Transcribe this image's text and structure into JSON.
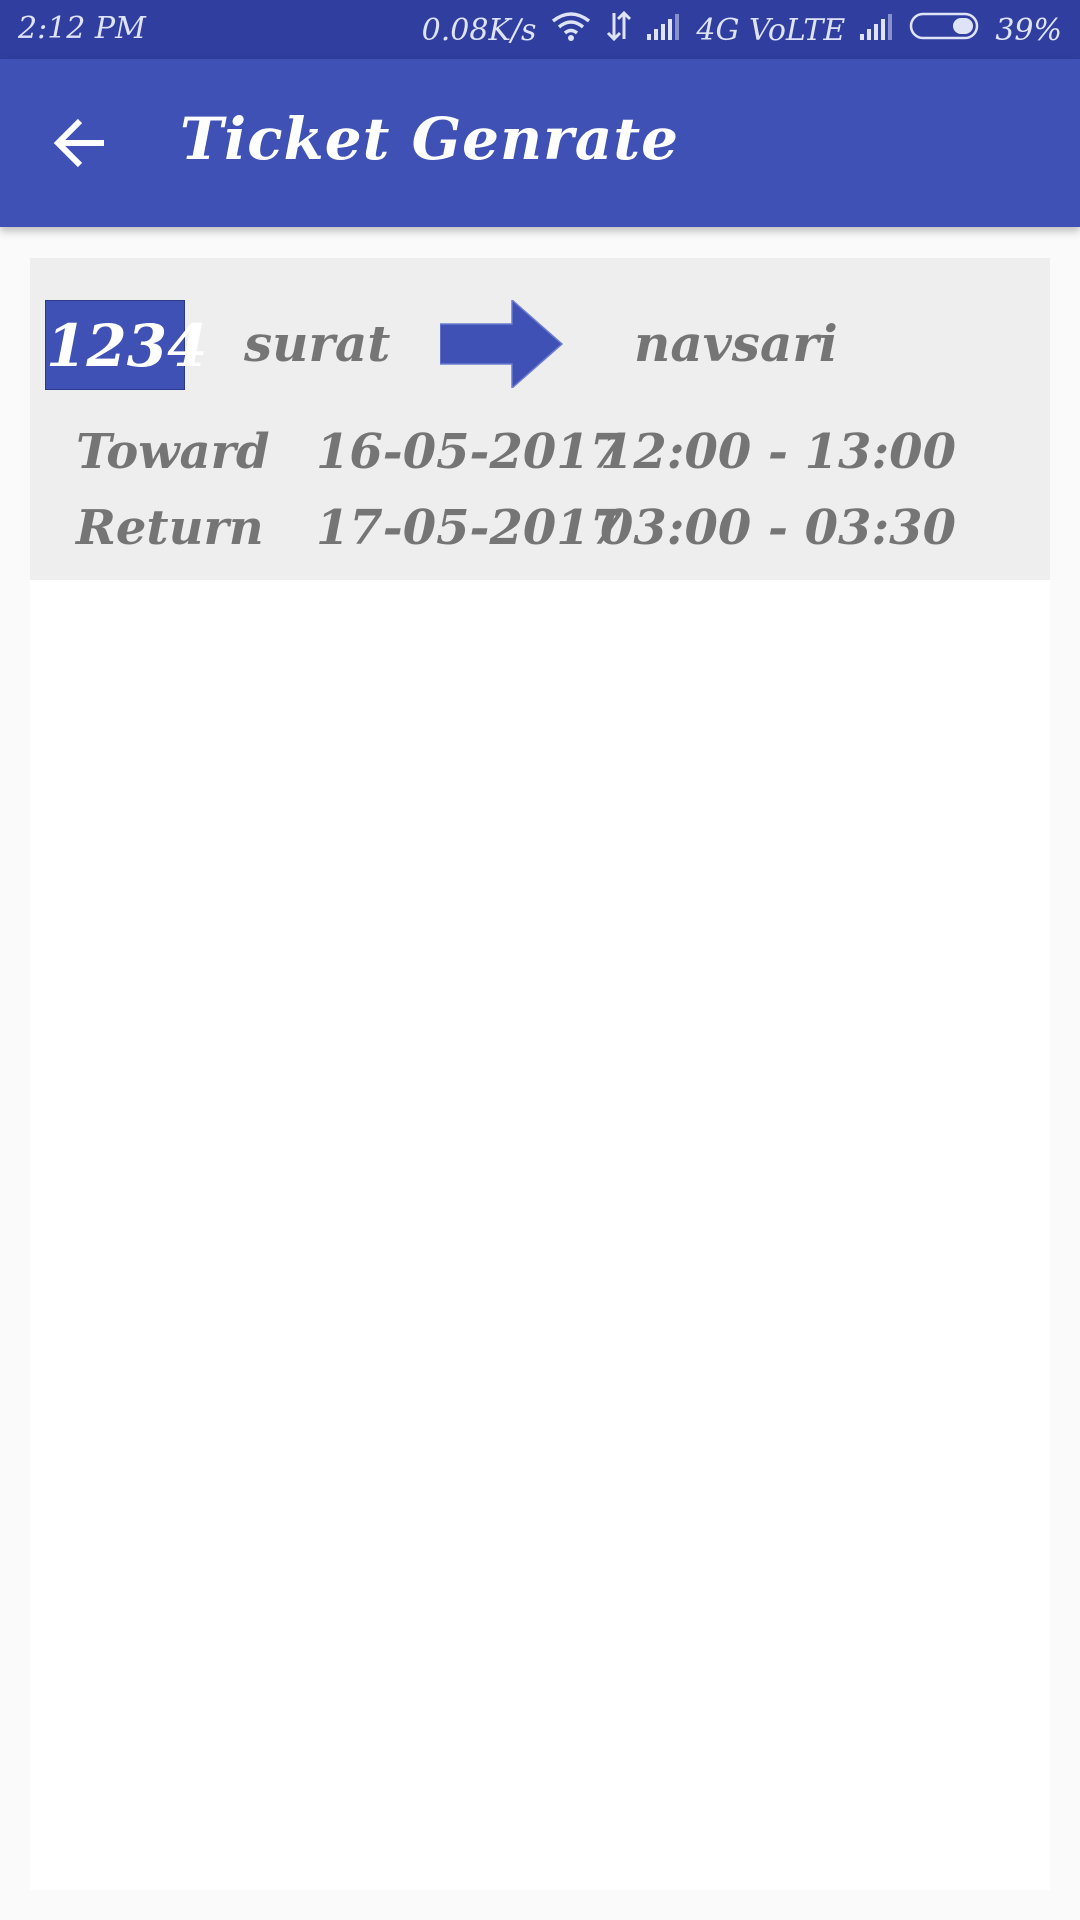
{
  "status_bar": {
    "time": "2:12 PM",
    "net_speed": "0.08K/s",
    "network": "4G VoLTE",
    "battery": "39%",
    "icons": [
      "wifi-icon",
      "data-transfer-icon",
      "signal-icon",
      "signal-icon",
      "battery-icon"
    ]
  },
  "app_bar": {
    "title": "Ticket Genrate",
    "back_icon": "arrow-left-icon"
  },
  "ticket": {
    "number": "1234",
    "from": "surat",
    "to": "navsari",
    "arrow_icon": "arrow-right-icon",
    "toward": {
      "label": "Toward",
      "date": "16-05-2017",
      "time": "12:00 - 13:00"
    },
    "return": {
      "label": "Return",
      "date": "17-05-2017",
      "time": "03:00 - 03:30"
    }
  },
  "colors": {
    "primary": "#3f51b5",
    "primary_dark": "#303f9f",
    "card_bg": "#eeeeee",
    "text_gray": "#757575"
  }
}
